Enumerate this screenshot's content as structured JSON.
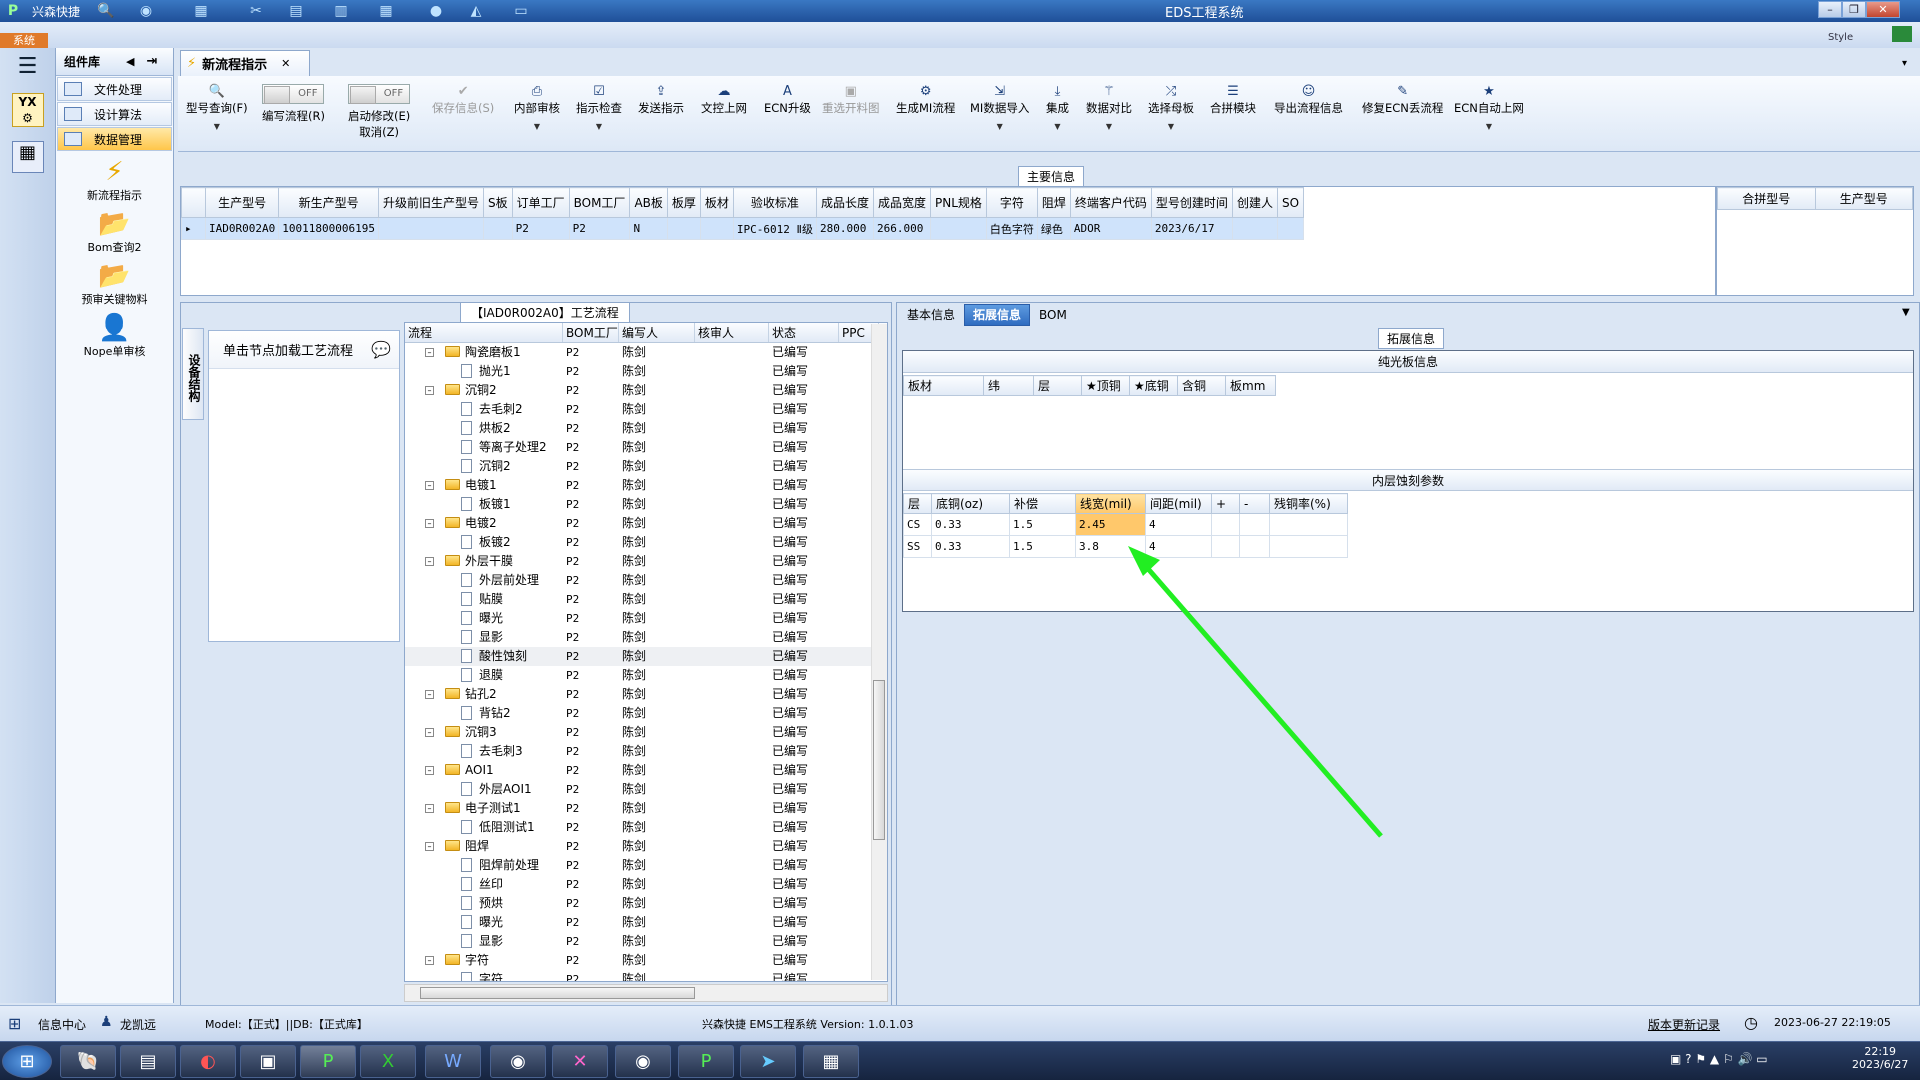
{
  "app": {
    "title": "EDS工程系统",
    "brand": "兴森快捷",
    "system_tab": "系统",
    "style_label": "Style"
  },
  "component_panel": {
    "title": "组件库",
    "items": [
      {
        "label": "文件处理"
      },
      {
        "label": "设计算法"
      },
      {
        "label": "数据管理"
      }
    ],
    "big_items": [
      {
        "label": "新流程指示"
      },
      {
        "label": "Bom查询2"
      },
      {
        "label": "预审关键物料"
      },
      {
        "label": "Nope单审核"
      }
    ]
  },
  "doc_tab": {
    "label": "新流程指示"
  },
  "toolbar": {
    "buttons": [
      {
        "label": "型号查询(F)",
        "icon": "magnifier"
      },
      {
        "label": "编写流程(R)",
        "toggle": "OFF"
      },
      {
        "label": "启动修改(E)",
        "toggle": "OFF",
        "sub": "取消(Z)"
      },
      {
        "label": "保存信息(S)",
        "icon": "check",
        "disabled": true
      },
      {
        "label": "内部审核",
        "icon": "printer"
      },
      {
        "label": "指示检查",
        "icon": "checkbox"
      },
      {
        "label": "发送指示",
        "icon": "upload"
      },
      {
        "label": "文控上网",
        "icon": "cloud"
      },
      {
        "label": "ECN升级",
        "icon": "a-letter"
      },
      {
        "label": "重选开料图",
        "icon": "image",
        "disabled": true
      },
      {
        "label": "生成MI流程",
        "icon": "gears"
      },
      {
        "label": "MI数据导入",
        "icon": "import"
      },
      {
        "label": "集成",
        "icon": "download"
      },
      {
        "label": "数据对比",
        "icon": "wand"
      },
      {
        "label": "选择母板",
        "icon": "shuffle"
      },
      {
        "label": "合拼模块",
        "icon": "list"
      },
      {
        "label": "导出流程信息",
        "icon": "smile"
      },
      {
        "label": "修复ECN丢流程",
        "icon": "wrench"
      },
      {
        "label": "ECN自动上网",
        "icon": "star"
      }
    ]
  },
  "main_info": {
    "title": "主要信息",
    "columns": [
      "生产型号",
      "新生产型号",
      "升级前旧生产型号",
      "S板",
      "订单工厂",
      "BOM工厂",
      "AB板",
      "板厚",
      "板材",
      "验收标准",
      "成品长度",
      "成品宽度",
      "PNL规格",
      "字符",
      "阻焊",
      "终端客户代码",
      "型号创建时间",
      "创建人",
      "SO"
    ],
    "rows": [
      [
        "IAD0R002A0",
        "10011800006195",
        "",
        "",
        "P2",
        "P2",
        "N",
        "",
        "",
        "IPC-6012 Ⅱ级",
        "280.000",
        "266.000",
        "",
        "白色字符",
        "绿色",
        "ADOR",
        "2023/6/17",
        "",
        ""
      ]
    ]
  },
  "merge_panel": {
    "columns": [
      "合拼型号",
      "生产型号"
    ]
  },
  "process": {
    "title": "【IAD0R002A0】工艺流程",
    "side_label": "设备结构",
    "click_prompt": "单击节点加载工艺流程",
    "columns": [
      "流程",
      "BOM工厂",
      "编写人",
      "核审人",
      "状态",
      "PPC"
    ],
    "rows": [
      {
        "level": 1,
        "name": "陶瓷磨板1",
        "bom": "P2",
        "writer": "陈剑",
        "status": "已编写"
      },
      {
        "level": 2,
        "name": "抛光1",
        "bom": "P2",
        "writer": "陈剑",
        "status": "已编写"
      },
      {
        "level": 1,
        "name": "沉铜2",
        "bom": "P2",
        "writer": "陈剑",
        "status": "已编写"
      },
      {
        "level": 2,
        "name": "去毛刺2",
        "bom": "P2",
        "writer": "陈剑",
        "status": "已编写"
      },
      {
        "level": 2,
        "name": "烘板2",
        "bom": "P2",
        "writer": "陈剑",
        "status": "已编写"
      },
      {
        "level": 2,
        "name": "等离子处理2",
        "bom": "P2",
        "writer": "陈剑",
        "status": "已编写"
      },
      {
        "level": 2,
        "name": "沉铜2",
        "bom": "P2",
        "writer": "陈剑",
        "status": "已编写"
      },
      {
        "level": 1,
        "name": "电镀1",
        "bom": "P2",
        "writer": "陈剑",
        "status": "已编写"
      },
      {
        "level": 2,
        "name": "板镀1",
        "bom": "P2",
        "writer": "陈剑",
        "status": "已编写"
      },
      {
        "level": 1,
        "name": "电镀2",
        "bom": "P2",
        "writer": "陈剑",
        "status": "已编写"
      },
      {
        "level": 2,
        "name": "板镀2",
        "bom": "P2",
        "writer": "陈剑",
        "status": "已编写"
      },
      {
        "level": 1,
        "name": "外层干膜",
        "bom": "P2",
        "writer": "陈剑",
        "status": "已编写"
      },
      {
        "level": 2,
        "name": "外层前处理",
        "bom": "P2",
        "writer": "陈剑",
        "status": "已编写"
      },
      {
        "level": 2,
        "name": "贴膜",
        "bom": "P2",
        "writer": "陈剑",
        "status": "已编写"
      },
      {
        "level": 2,
        "name": "曝光",
        "bom": "P2",
        "writer": "陈剑",
        "status": "已编写"
      },
      {
        "level": 2,
        "name": "显影",
        "bom": "P2",
        "writer": "陈剑",
        "status": "已编写"
      },
      {
        "level": 2,
        "name": "酸性蚀刻",
        "bom": "P2",
        "writer": "陈剑",
        "status": "已编写",
        "highlight": true
      },
      {
        "level": 2,
        "name": "退膜",
        "bom": "P2",
        "writer": "陈剑",
        "status": "已编写"
      },
      {
        "level": 1,
        "name": "钻孔2",
        "bom": "P2",
        "writer": "陈剑",
        "status": "已编写"
      },
      {
        "level": 2,
        "name": "背钻2",
        "bom": "P2",
        "writer": "陈剑",
        "status": "已编写"
      },
      {
        "level": 1,
        "name": "沉铜3",
        "bom": "P2",
        "writer": "陈剑",
        "status": "已编写"
      },
      {
        "level": 2,
        "name": "去毛刺3",
        "bom": "P2",
        "writer": "陈剑",
        "status": "已编写"
      },
      {
        "level": 1,
        "name": "AOI1",
        "bom": "P2",
        "writer": "陈剑",
        "status": "已编写"
      },
      {
        "level": 2,
        "name": "外层AOI1",
        "bom": "P2",
        "writer": "陈剑",
        "status": "已编写"
      },
      {
        "level": 1,
        "name": "电子测试1",
        "bom": "P2",
        "writer": "陈剑",
        "status": "已编写"
      },
      {
        "level": 2,
        "name": "低阻测试1",
        "bom": "P2",
        "writer": "陈剑",
        "status": "已编写"
      },
      {
        "level": 1,
        "name": "阻焊",
        "bom": "P2",
        "writer": "陈剑",
        "status": "已编写"
      },
      {
        "level": 2,
        "name": "阻焊前处理",
        "bom": "P2",
        "writer": "陈剑",
        "status": "已编写"
      },
      {
        "level": 2,
        "name": "丝印",
        "bom": "P2",
        "writer": "陈剑",
        "status": "已编写"
      },
      {
        "level": 2,
        "name": "预烘",
        "bom": "P2",
        "writer": "陈剑",
        "status": "已编写"
      },
      {
        "level": 2,
        "name": "曝光",
        "bom": "P2",
        "writer": "陈剑",
        "status": "已编写"
      },
      {
        "level": 2,
        "name": "显影",
        "bom": "P2",
        "writer": "陈剑",
        "status": "已编写"
      },
      {
        "level": 1,
        "name": "字符",
        "bom": "P2",
        "writer": "陈剑",
        "status": "已编写"
      },
      {
        "level": 2,
        "name": "字符",
        "bom": "P2",
        "writer": "陈剑",
        "status": "已编写"
      }
    ]
  },
  "right_panel": {
    "tabs": [
      {
        "label": "基本信息"
      },
      {
        "label": "拓展信息",
        "active": true
      },
      {
        "label": "BOM"
      }
    ],
    "section_title": "拓展信息",
    "plain_board": {
      "title": "纯光板信息",
      "columns": [
        "板材",
        "纬",
        "层",
        "★顶铜",
        "★底铜",
        "含铜",
        "板mm"
      ]
    },
    "inner_etch": {
      "title": "内层蚀刻参数",
      "columns": [
        "层",
        "底铜(oz)",
        "补偿",
        "线宽(mil)",
        "间距(mil)",
        "+",
        "-",
        "残铜率(%)"
      ],
      "rows": [
        [
          "CS",
          "0.33",
          "1.5",
          "2.45",
          "4",
          "",
          "",
          ""
        ],
        [
          "SS",
          "0.33",
          "1.5",
          "3.8",
          "4",
          "",
          "",
          ""
        ]
      ]
    }
  },
  "status_bar": {
    "info_center": "信息中心",
    "user": "龙凯远",
    "model_db": "Model:【正式】||DB:【正式库】",
    "version": "兴森快捷 EMS工程系统 Version: 1.0.1.03",
    "update_log": "版本更新记录",
    "datetime": "2023-06-27 22:19:05"
  },
  "taskbar": {
    "time": "22:19",
    "date": "2023/6/27"
  },
  "colors": {
    "accent": "#2f6cc0",
    "highlight_cell": "#ffc86b",
    "arrow": "#22ee22"
  }
}
